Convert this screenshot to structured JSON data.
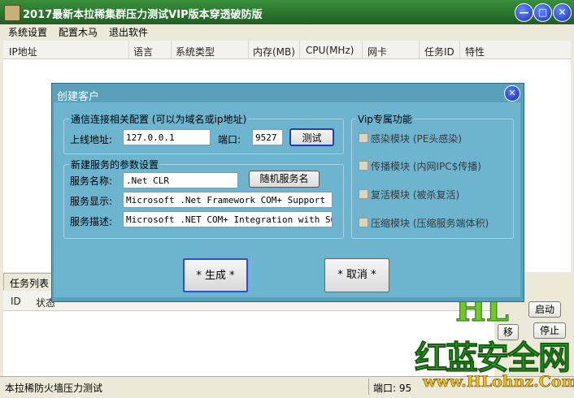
{
  "window": {
    "title": "2017最新本拉稀集群压力测试VIP版本穿透破防版",
    "min_label": "—",
    "max_label": "□",
    "close_label": "✕"
  },
  "menu": [
    "系统设置",
    "配置木马",
    "退出软件"
  ],
  "grid": {
    "columns": [
      "IP地址",
      "语言",
      "系统类型",
      "内存(MB)",
      "CPU(MHz)",
      "网卡",
      "任务ID",
      "特性"
    ]
  },
  "tasks": {
    "title": "任务列表",
    "columns": [
      "ID",
      "状态"
    ],
    "buttons": {
      "start": "启动",
      "move": "移",
      "stop": "停止"
    }
  },
  "status": {
    "left": "本拉稀防火墙压力测试",
    "port_label": "端口: 95"
  },
  "watermark": {
    "line1": "HL",
    "line2": "红蓝安全网",
    "line3": "www.HLohnz.Com"
  },
  "dialog": {
    "title": "创建客户",
    "close_label": "✕",
    "conn_group": {
      "title": "通信连接相关配置 (可以为域名或ip地址)",
      "host_label": "上线地址:",
      "host_value": "127.0.0.1",
      "port_label": "端口:",
      "port_value": "9527",
      "test_button": "测试"
    },
    "service_group": {
      "title": "新建服务的参数设置",
      "name_label": "服务名称:",
      "name_value": ".Net CLR",
      "random_button": "随机服务名",
      "display_label": "服务显示:",
      "display_value": "Microsoft .Net Framework COM+ Support",
      "desc_label": "服务描述:",
      "desc_value": "Microsoft .NET COM+ Integration with SOAP"
    },
    "vip_group": {
      "title": "Vip专属功能",
      "options": [
        {
          "label": "感染模块 (PE头感染)",
          "checked": false
        },
        {
          "label": "传播模块 (内网IPC$传播)",
          "checked": false
        },
        {
          "label": "复活模块 (被杀复活)",
          "checked": false
        },
        {
          "label": "压缩模块 (压缩服务端体积)",
          "checked": false
        }
      ]
    },
    "generate_button": "* 生成 *",
    "cancel_button": "* 取消 *"
  }
}
